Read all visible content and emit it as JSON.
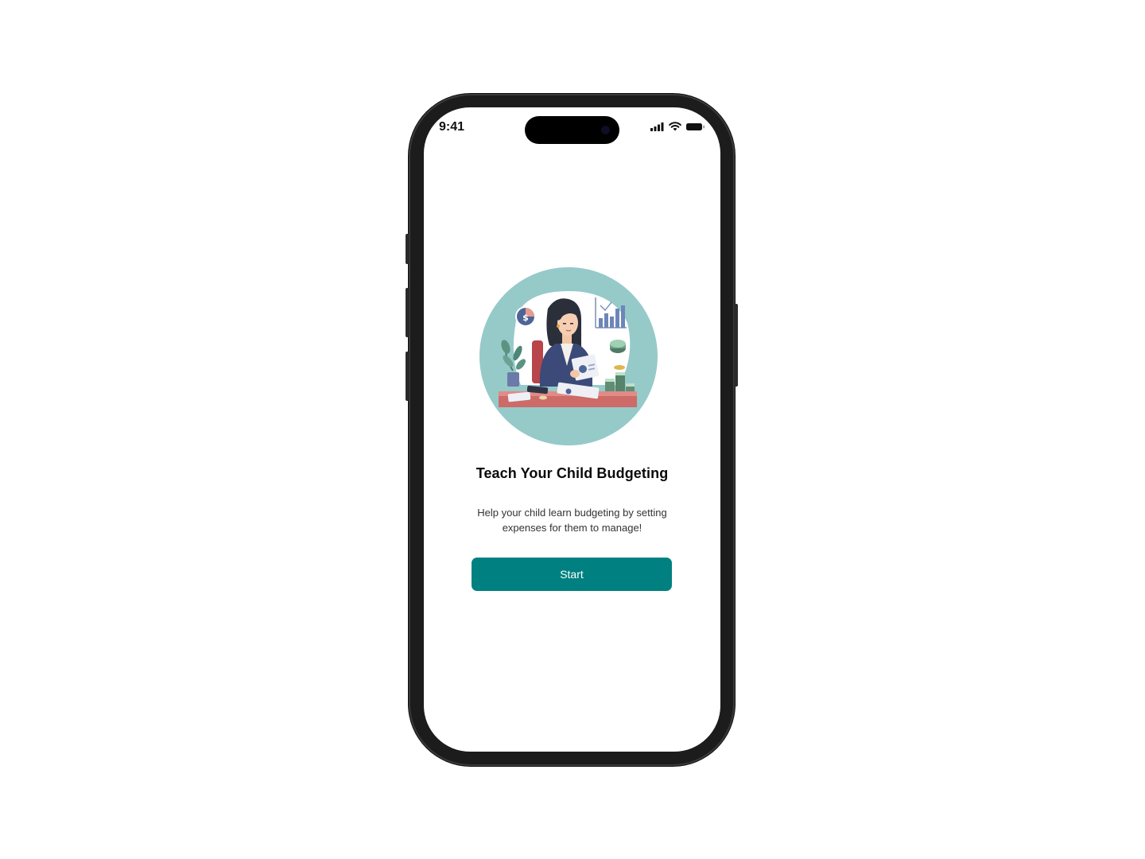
{
  "status_bar": {
    "time": "9:41",
    "icons": [
      "signal-icon",
      "wifi-icon",
      "battery-icon"
    ]
  },
  "onboarding": {
    "title": "Teach Your Child Budgeting",
    "description": "Help your child learn budgeting by setting expenses for them to manage!",
    "start_label": "Start"
  },
  "colors": {
    "accent": "#008080",
    "illustration_bg": "#95cac9"
  }
}
